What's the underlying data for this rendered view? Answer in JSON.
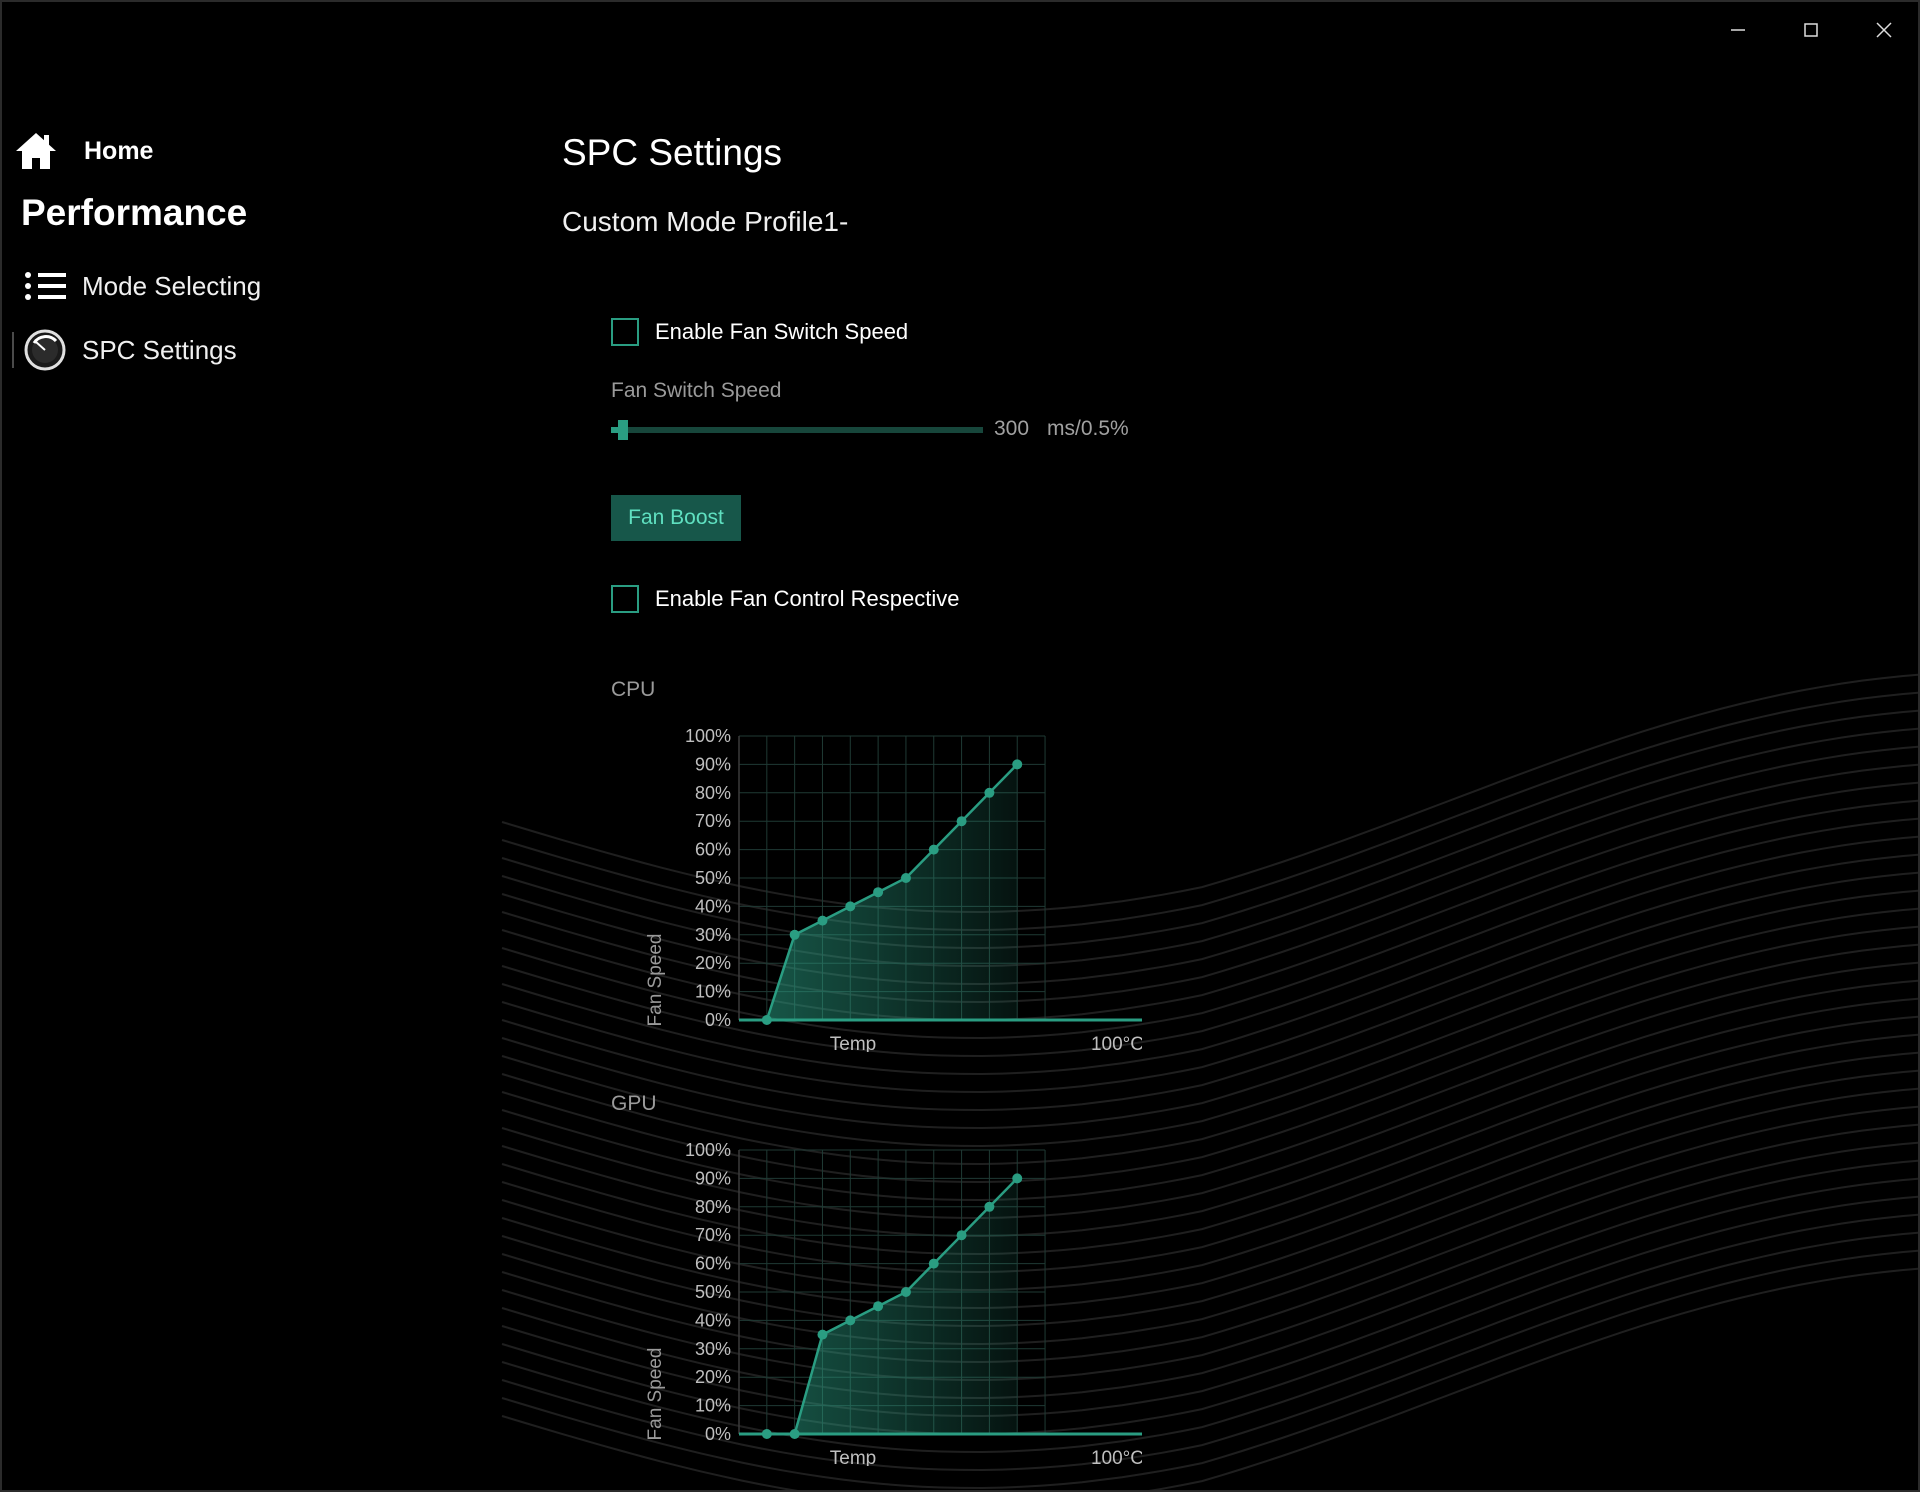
{
  "window": {
    "controls": [
      "minimize",
      "maximize",
      "close"
    ]
  },
  "sidebar": {
    "home_label": "Home",
    "section_title": "Performance",
    "items": [
      {
        "label": "Mode Selecting",
        "icon": "list-icon"
      },
      {
        "label": "SPC Settings",
        "icon": "gauge-icon",
        "selected": true
      }
    ]
  },
  "main": {
    "page_title": "SPC Settings",
    "profile_title": "Custom Mode Profile1-",
    "enable_fan_switch_speed": {
      "label": "Enable Fan Switch Speed",
      "checked": false
    },
    "fan_switch_speed": {
      "label": "Fan Switch Speed",
      "value": "300",
      "unit": "ms/0.5%",
      "fraction": 0.02
    },
    "fan_boost_label": "Fan Boost",
    "enable_fan_control_respective": {
      "label": "Enable Fan Control Respective",
      "checked": false
    },
    "cpu_label": "CPU",
    "gpu_label": "GPU"
  },
  "colors": {
    "accent": "#2a9d82",
    "accent_dark": "#17574a",
    "accent_text": "#5fe0c0",
    "grid": "#1f3a34",
    "text_muted": "#9a9a9a"
  },
  "chart_data": [
    {
      "type": "area",
      "name": "CPU",
      "ylabel": "Fan Speed",
      "xlabel": "Temp",
      "x_end_label": "100°C",
      "y_ticks": [
        "0%",
        "10%",
        "20%",
        "30%",
        "40%",
        "50%",
        "60%",
        "70%",
        "80%",
        "90%",
        "100%"
      ],
      "ylim": [
        0,
        100
      ],
      "x_steps": 11,
      "points": [
        [
          1,
          0
        ],
        [
          2,
          30
        ],
        [
          3,
          35
        ],
        [
          4,
          40
        ],
        [
          5,
          45
        ],
        [
          6,
          50
        ],
        [
          7,
          60
        ],
        [
          8,
          70
        ],
        [
          9,
          80
        ],
        [
          10,
          90
        ]
      ]
    },
    {
      "type": "area",
      "name": "GPU",
      "ylabel": "Fan Speed",
      "xlabel": "Temp",
      "x_end_label": "100°C",
      "y_ticks": [
        "0%",
        "10%",
        "20%",
        "30%",
        "40%",
        "50%",
        "60%",
        "70%",
        "80%",
        "90%",
        "100%"
      ],
      "ylim": [
        0,
        100
      ],
      "x_steps": 11,
      "points": [
        [
          1,
          0
        ],
        [
          2,
          0
        ],
        [
          3,
          35
        ],
        [
          4,
          40
        ],
        [
          5,
          45
        ],
        [
          6,
          50
        ],
        [
          7,
          60
        ],
        [
          8,
          70
        ],
        [
          9,
          80
        ],
        [
          10,
          90
        ]
      ]
    }
  ]
}
